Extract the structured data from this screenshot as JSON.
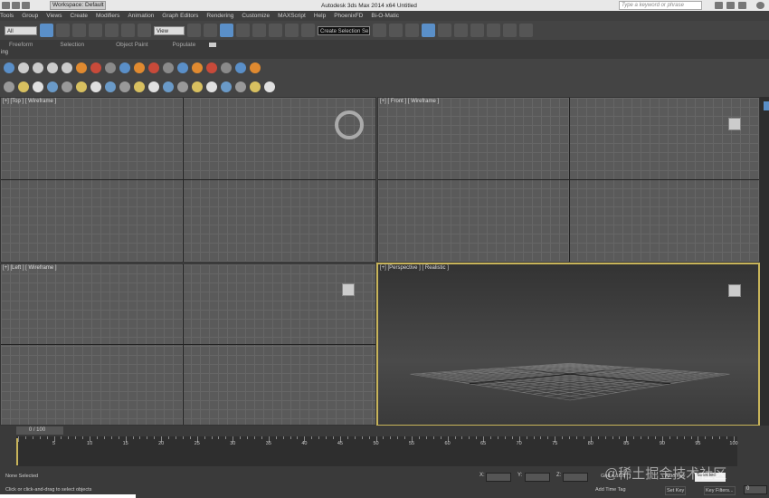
{
  "titlebar": {
    "workspace": "Workspace: Default",
    "title": "Autodesk 3ds Max  2014 x64     Untitled",
    "search_placeholder": "Type a keyword or phrase"
  },
  "menu": [
    "Tools",
    "Group",
    "Views",
    "Create",
    "Modifiers",
    "Animation",
    "Graph Editors",
    "Rendering",
    "Customize",
    "MAXScript",
    "Help",
    "PhoenixFD",
    "Bi-O-Matic"
  ],
  "toolbar": {
    "filter": "All",
    "ref_coord": "View",
    "selection_set": "Create Selection Se"
  },
  "ribbon": [
    "Freeform",
    "Selection",
    "Object Paint",
    "Populate"
  ],
  "ribbon_panel": "ing",
  "viewports": {
    "top": "[+] [Top ] [ Wireframe ]",
    "front": "[+] [ Front ] [ Wireframe ]",
    "left": "[+] [Left ] [ Wireframe ]",
    "perspective": "[+] [Perspective ] [ Realistic ]"
  },
  "timeline": {
    "slider": "0 / 100",
    "ticks": [
      "5",
      "10",
      "15",
      "20",
      "25",
      "30",
      "35",
      "40",
      "45",
      "50",
      "55",
      "60",
      "65",
      "70",
      "75",
      "80",
      "85",
      "90",
      "95",
      "100"
    ]
  },
  "status": {
    "selection": "None Selected",
    "prompt": "Click or click-and-drag to select objects",
    "x_label": "X:",
    "y_label": "Y:",
    "z_label": "Z:",
    "grid": "Grid = 10.0",
    "add_time_tag": "Add Time Tag",
    "set_key": "Set Key",
    "key_filters": "Key Filters...",
    "auto_key": "Auto Key",
    "selected": "Selected",
    "frame": "0"
  },
  "watermark": "@稀土掘金技术社区"
}
